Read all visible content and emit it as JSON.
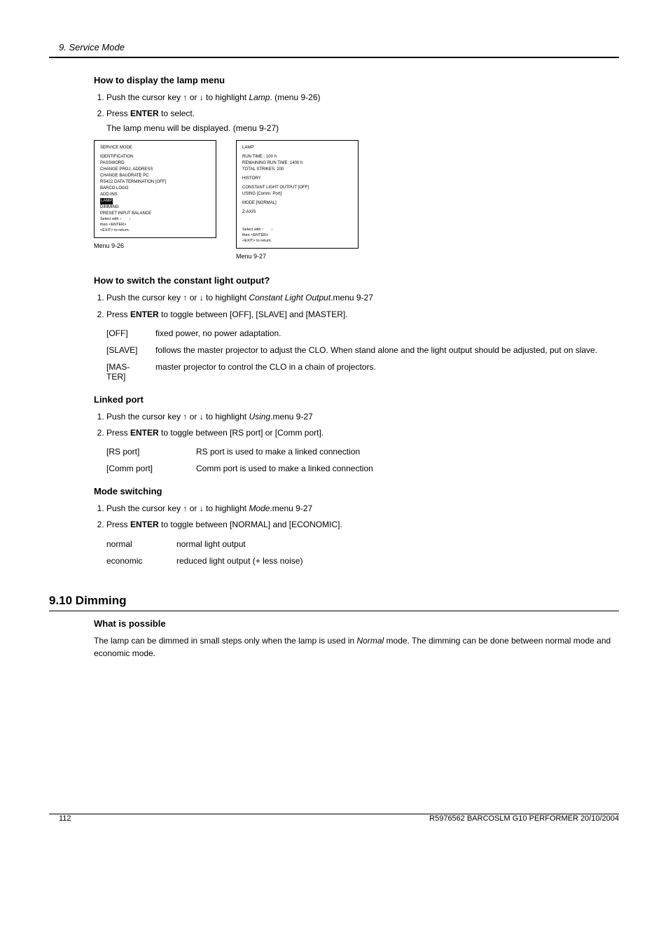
{
  "header": {
    "chapter": "9. Service Mode"
  },
  "lampMenu": {
    "heading": "How to display the lamp menu",
    "step1_a": "Push the cursor key ↑ or ↓ to highlight ",
    "step1_i": "Lamp",
    "step1_b": ". (menu 9-26)",
    "step2_a": "Press ",
    "step2_bold": "ENTER",
    "step2_b": " to select.",
    "step2_result": "The lamp menu will be displayed. (menu 9-27)"
  },
  "figs": {
    "box1": {
      "title": "SERVICE MODE",
      "lines": [
        "IDENTIFICATION",
        "PASSWORD",
        "CHANGE PROJ. ADDRESS",
        "CHANGE BAUDRATE PC",
        "RS422 DATA TERMINATION [OFF]",
        "BARCO LOGO",
        "ADD-INS"
      ],
      "hl": "LAMP",
      "lines2": [
        "DIMMING",
        "PRESET INPUT BALANCE"
      ],
      "footer1": "Select with ",
      "footer2": "then <ENTER>",
      "footer3": "<EXIT> to return.",
      "caption": "Menu 9-26"
    },
    "box2": {
      "title": "LAMP",
      "l1": "RUN TIME : 100 h",
      "l2": "REMAINING RUN TIME: 1400 h",
      "l3": "TOTAL STRIKES: 200",
      "l4": "HISTORY",
      "l5": "CONSTANT LIGHT OUTPUT [OFF]",
      "l6": "USING [Comm. Port]",
      "l7": "MODE [NORMAL]",
      "l8": "Z-AXIS",
      "footer1": "Select with ",
      "footer2": "then <ENTER>",
      "footer3": "<EXIT> to return.",
      "caption": "Menu 9-27"
    }
  },
  "clo": {
    "heading": "How to switch the constant light output?",
    "step1_a": "Push the cursor key ↑ or ↓ to highlight ",
    "step1_i": "Constant Light Output",
    "step1_b": ".menu 9-27",
    "step2_a": "Press ",
    "step2_bold": "ENTER",
    "step2_b": " to toggle between [OFF], [SLAVE] and [MASTER].",
    "rows": [
      {
        "term": "[OFF]",
        "desc": "fixed power, no power adaptation."
      },
      {
        "term": "[SLAVE]",
        "desc": "follows the master projector to adjust the CLO. When stand alone and the light output should be adjusted, put on slave."
      },
      {
        "term": "[MAS-\nTER]",
        "desc": "master projector to control the CLO in a chain of projectors."
      }
    ]
  },
  "linked": {
    "heading": "Linked port",
    "step1_a": "Push the cursor key ↑ or ↓ to highlight ",
    "step1_i": "Using",
    "step1_b": ".menu 9-27",
    "step2_a": "Press ",
    "step2_bold": "ENTER",
    "step2_b": " to toggle between [RS port] or [Comm port].",
    "rows": [
      {
        "term": "[RS port]",
        "desc": "RS port is used to make a linked connection"
      },
      {
        "term": "[Comm port]",
        "desc": "Comm port is used to make a linked connection"
      }
    ]
  },
  "mode": {
    "heading": "Mode switching",
    "step1_a": "Push the cursor key ↑ or ↓ to highlight ",
    "step1_i": "Mode",
    "step1_b": ".menu 9-27",
    "step2_a": "Press ",
    "step2_bold": "ENTER",
    "step2_b": " to toggle between [NORMAL] and [ECONOMIC].",
    "rows": [
      {
        "term": "normal",
        "desc": "normal light output"
      },
      {
        "term": "economic",
        "desc": "reduced light output (+ less noise)"
      }
    ]
  },
  "dimming": {
    "heading": "9.10 Dimming",
    "sub": "What is possible",
    "body_a": "The lamp can be dimmed in small steps only when the lamp is used in ",
    "body_i": "Normal",
    "body_b": " mode. The dimming can be done between normal mode and economic mode."
  },
  "footer": {
    "page": "112",
    "doc": "R5976562 BARCOSLM G10 PERFORMER 20/10/2004"
  }
}
